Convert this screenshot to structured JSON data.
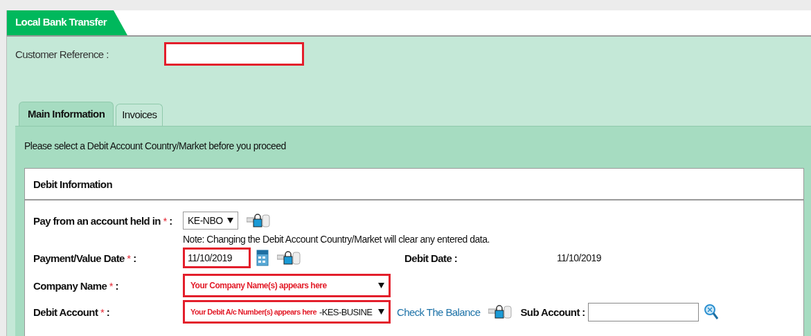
{
  "header_tab": {
    "label": "Local Bank Transfer"
  },
  "customer_reference": {
    "label": "Customer Reference :",
    "highlighted": true
  },
  "tabs": [
    {
      "label": "Main Information",
      "selected": true
    },
    {
      "label": "Invoices",
      "selected": false
    }
  ],
  "notice": "Please select a Debit Account Country/Market before you proceed",
  "section": {
    "title": "Debit Information",
    "pay_from": {
      "label": "Pay from an account held in",
      "required_mark": "*",
      "colon": ":",
      "value": "KE-NBO",
      "note": "Note: Changing the Debit Account Country/Market will clear any entered data."
    },
    "payment_date": {
      "label": "Payment/Value Date",
      "required_mark": "*",
      "colon": ":",
      "value": "11/10/2019",
      "highlighted": true
    },
    "debit_date": {
      "label": "Debit Date :",
      "value": "11/10/2019"
    },
    "company_name": {
      "label": "Company Name",
      "required_mark": "*",
      "colon": ":",
      "value": "Your Company Name(s) appears here",
      "highlighted": true
    },
    "debit_account": {
      "label": "Debit Account",
      "required_mark": "*",
      "colon": ":",
      "value": "Your Debit A/c Number(s) appears here",
      "value_suffix": "-KES-BUSINE",
      "highlighted": true
    },
    "balance_link": "Check The Balance",
    "sub_account": {
      "label": "Sub Account :"
    }
  }
}
